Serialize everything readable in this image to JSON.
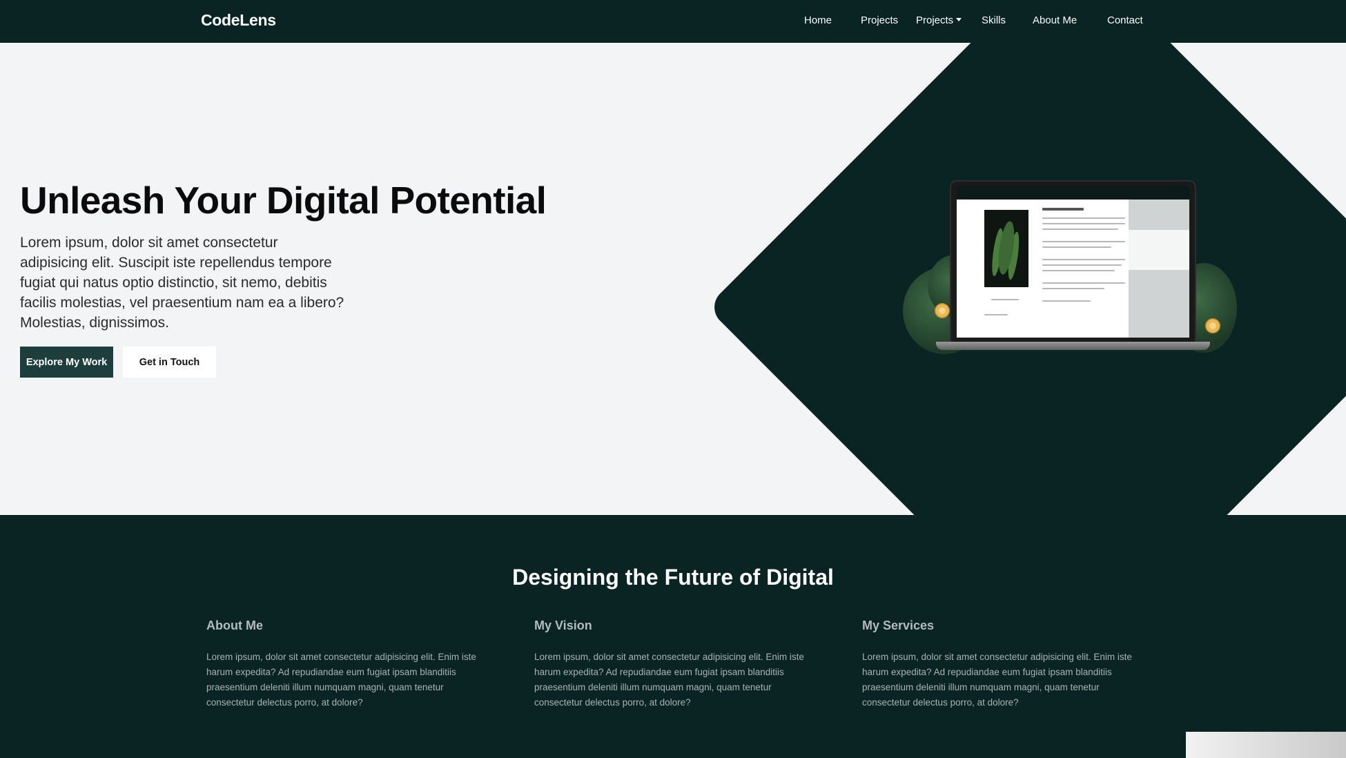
{
  "navbar": {
    "brand": "CodeLens",
    "links": [
      "Home",
      "Projects",
      "Projects",
      "Skills",
      "About Me",
      "Contact"
    ]
  },
  "hero": {
    "title": "Unleash Your Digital Potential",
    "description": "Lorem ipsum, dolor sit amet consectetur adipisicing elit. Suscipit iste repellendus tempore fugiat qui natus optio distinctio, sit nemo, debitis facilis molestias, vel praesentium nam ea a libero? Molestias, dignissimos.",
    "primary_button": "Explore My Work",
    "secondary_button": "Get in Touch"
  },
  "about": {
    "title": "Designing the Future of Digital",
    "columns": [
      {
        "title": "About Me",
        "text": "Lorem ipsum, dolor sit amet consectetur adipisicing elit. Enim iste harum expedita? Ad repudiandae eum fugiat ipsam blanditiis praesentium deleniti illum numquam magni, quam tenetur consectetur delectus porro, at dolore?"
      },
      {
        "title": "My Vision",
        "text": "Lorem ipsum, dolor sit amet consectetur adipisicing elit. Enim iste harum expedita? Ad repudiandae eum fugiat ipsam blanditiis praesentium deleniti illum numquam magni, quam tenetur consectetur delectus porro, at dolore?"
      },
      {
        "title": "My Services",
        "text": "Lorem ipsum, dolor sit amet consectetur adipisicing elit. Enim iste harum expedita? Ad repudiandae eum fugiat ipsam blanditiis praesentium deleniti illum numquam magni, quam tenetur consectetur delectus porro, at dolore?"
      }
    ]
  },
  "colors": {
    "primary_dark": "#0a2424",
    "button_dark": "#1d3e3d",
    "background_light": "#f3f4f6"
  }
}
